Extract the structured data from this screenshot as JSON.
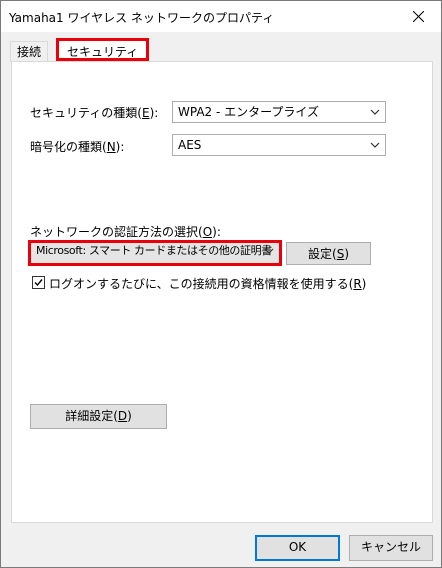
{
  "window": {
    "title": "Yamaha1 ワイヤレス ネットワークのプロパティ"
  },
  "tabs": [
    {
      "label": "接続"
    },
    {
      "label": "セキュリティ"
    }
  ],
  "security_type": {
    "label_pre": "セキュリティの種類(",
    "label_key": "E",
    "label_post": "):",
    "value": "WPA2 - エンタープライズ"
  },
  "encryption_type": {
    "label_pre": "暗号化の種類(",
    "label_key": "N",
    "label_post": "):",
    "value": "AES"
  },
  "auth_method": {
    "label_pre": "ネットワークの認証方法の選択(",
    "label_key": "O",
    "label_post": "):",
    "value": "Microsoft: スマート カードまたはその他の証明書"
  },
  "settings_button": {
    "pre": "設定(",
    "key": "S",
    "post": ")"
  },
  "remember_credentials": {
    "checked": true,
    "pre": "ログオンするたびに、この接続用の資格情報を使用する(",
    "key": "R",
    "post": ")"
  },
  "advanced_button": {
    "pre": "詳細設定(",
    "key": "D",
    "post": ")"
  },
  "footer": {
    "ok": "OK",
    "cancel": "キャンセル"
  }
}
